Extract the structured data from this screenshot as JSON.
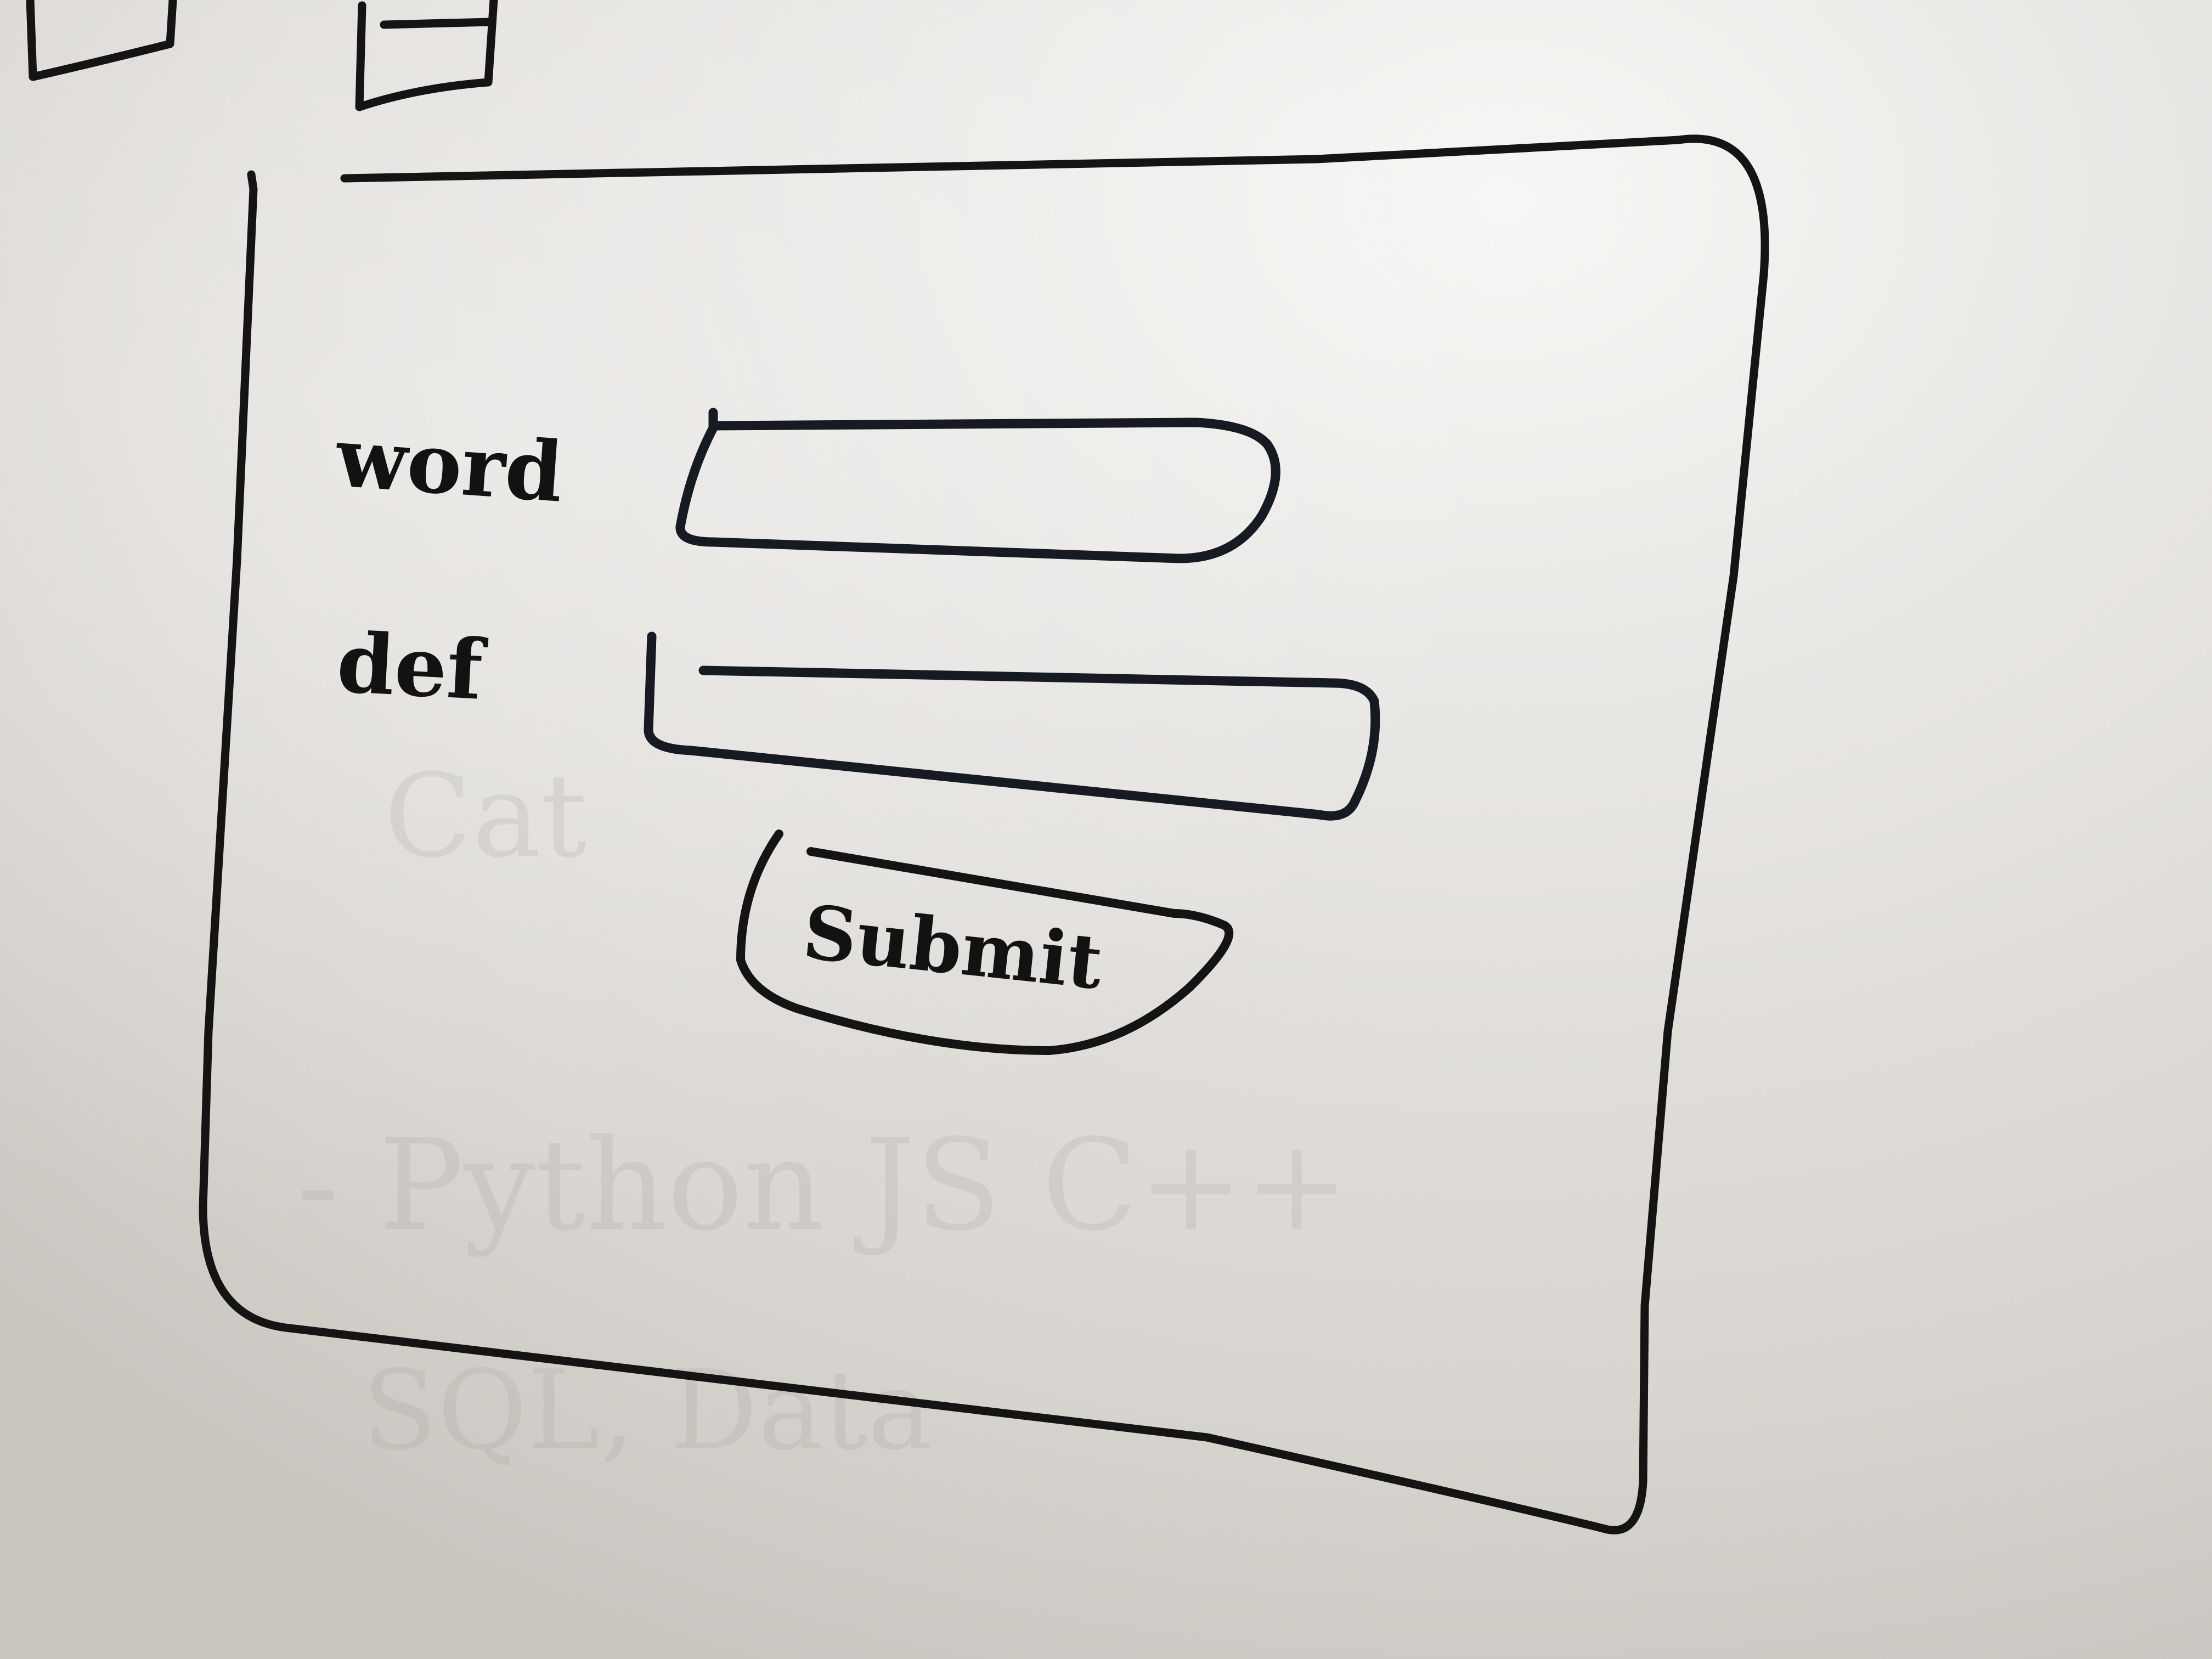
{
  "whiteboard": {
    "form": {
      "fields": [
        {
          "label": "word"
        },
        {
          "label": "def"
        }
      ],
      "submit_button": {
        "label": "Submit"
      }
    },
    "ghost_text": {
      "line1": "Cat",
      "line2": "- Python JS C++",
      "line3": "SQL, Data"
    },
    "colors": {
      "board": "#e7e4e0",
      "ink": "#141414"
    }
  }
}
